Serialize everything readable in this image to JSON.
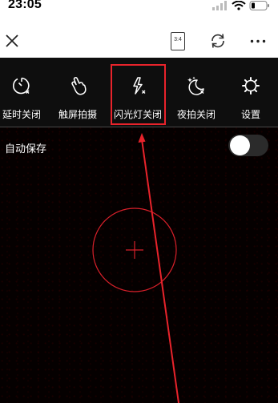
{
  "status_bar": {
    "time": "23:05",
    "icons": [
      "signal-icon",
      "wifi-icon",
      "battery-icon"
    ]
  },
  "top_bar": {
    "icons": [
      "close-icon",
      "aspect-ratio-icon",
      "switch-camera-icon",
      "more-icon"
    ],
    "aspect_ratio_label": "3:4"
  },
  "tools": [
    {
      "icon": "timer-off-icon",
      "label": "延时关闭"
    },
    {
      "icon": "touch-shoot-icon",
      "label": "触屏拍摄"
    },
    {
      "icon": "flash-off-icon",
      "label": "闪光灯关闭"
    },
    {
      "icon": "night-mode-off-icon",
      "label": "夜拍关闭"
    },
    {
      "icon": "settings-icon",
      "label": "设置"
    }
  ],
  "auto_save": {
    "label": "自动保存",
    "enabled": false
  },
  "colors": {
    "annotation_red": "#e8232b",
    "focus_ring": "#d8202a",
    "background": "#000000"
  },
  "annotation": {
    "highlighted_tool": "闪光灯关闭"
  }
}
